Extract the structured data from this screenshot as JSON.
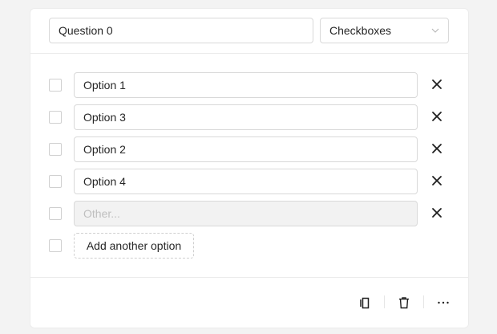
{
  "question": {
    "title": "Question 0",
    "type": "Checkboxes"
  },
  "options": [
    {
      "label": "Option 1"
    },
    {
      "label": "Option 3"
    },
    {
      "label": "Option 2"
    },
    {
      "label": "Option 4"
    }
  ],
  "other": {
    "placeholder": "Other..."
  },
  "add_option_label": "Add another option",
  "icons": {
    "dropdown": "chevron-down-icon",
    "delete": "close-icon",
    "copy": "copy-icon",
    "trash": "trash-icon",
    "more": "more-icon"
  }
}
